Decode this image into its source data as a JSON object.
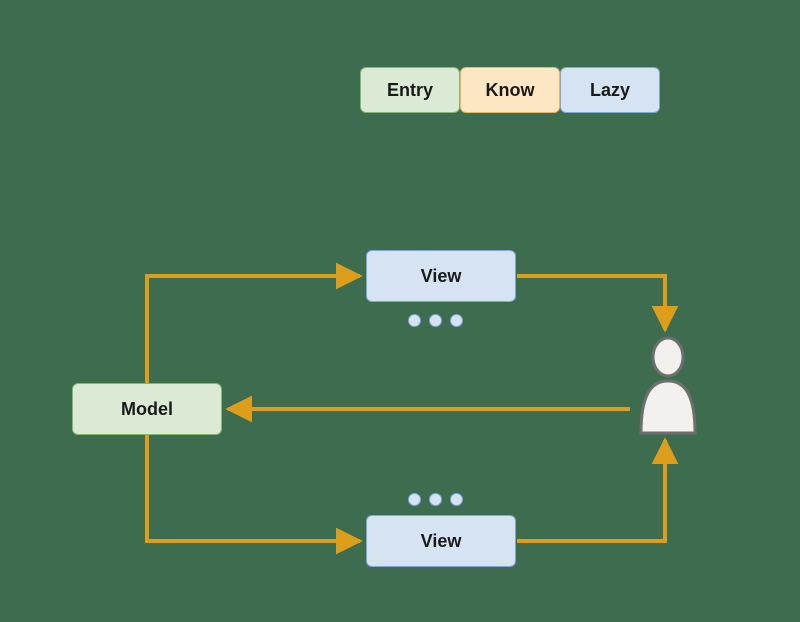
{
  "legend": {
    "entry": "Entry",
    "know": "Know",
    "lazy": "Lazy"
  },
  "nodes": {
    "model": "Model",
    "view_top": "View",
    "view_bottom": "View"
  },
  "colors": {
    "green_fill": "#dbead5",
    "green_border": "#7fb86e",
    "orange_fill": "#fde6c4",
    "orange_border": "#e8b566",
    "blue_fill": "#d5e3f3",
    "blue_border": "#7ca8d8",
    "arrow": "#dd9f1b",
    "background": "#3e6c4f",
    "person_fill": "#f3f1ee",
    "person_stroke": "#6f6f6f"
  }
}
